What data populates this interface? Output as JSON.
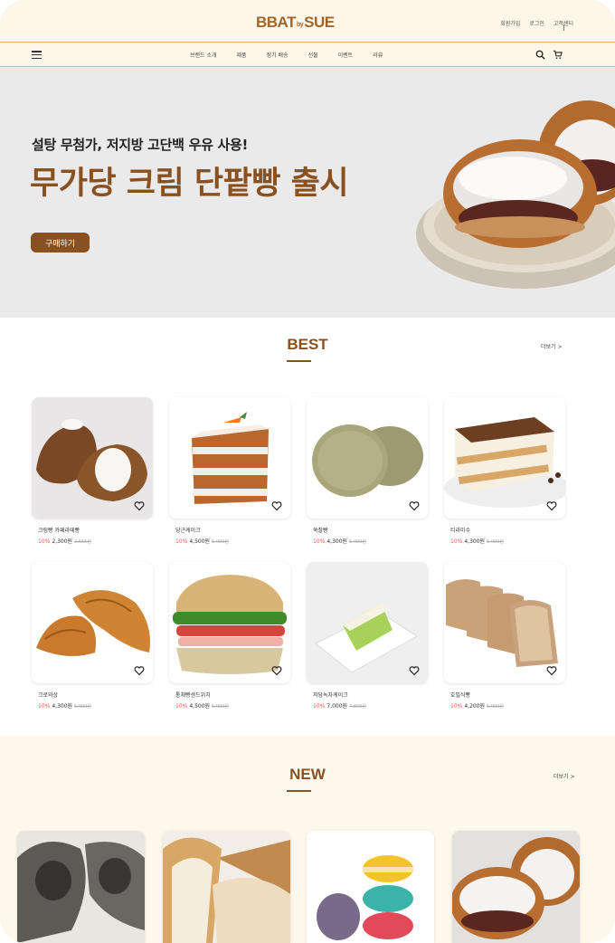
{
  "header": {
    "logo_main": "BBAT",
    "logo_small": "by",
    "logo_end": "SUE",
    "util_links": [
      "회원가입",
      "로그인",
      "고객센터"
    ]
  },
  "nav": {
    "items": [
      "브랜드 소개",
      "제품",
      "정기 배송",
      "선물",
      "이벤트",
      "리뷰"
    ],
    "icons": [
      "menu-icon",
      "search-icon",
      "cart-icon"
    ]
  },
  "hero": {
    "subtitle": "설탕 무첨가, 저지방 고단백 우유 사용!",
    "title": "무가당 크림 단팥빵 출시",
    "button": "구매하기"
  },
  "best": {
    "title": "BEST",
    "more": "더보기 >",
    "products": [
      {
        "name": "크림빵 카페라떼빵",
        "discount": "10%",
        "price": "2,300원",
        "original": "2,555원"
      },
      {
        "name": "당근케이크",
        "discount": "10%",
        "price": "4,500원",
        "original": "5,000원"
      },
      {
        "name": "쑥찰빵",
        "discount": "10%",
        "price": "4,300원",
        "original": "5,000원"
      },
      {
        "name": "티라미수",
        "discount": "10%",
        "price": "4,300원",
        "original": "5,000원"
      },
      {
        "name": "크로와상",
        "discount": "10%",
        "price": "4,300원",
        "original": "5,000원"
      },
      {
        "name": "통채빵샌드위치",
        "discount": "10%",
        "price": "4,500원",
        "original": "5,000원"
      },
      {
        "name": "저당녹차케이크",
        "discount": "10%",
        "price": "7,000원",
        "original": "7,800원"
      },
      {
        "name": "호밀식빵",
        "discount": "10%",
        "price": "4,200원",
        "original": "5,000원"
      }
    ]
  },
  "new": {
    "title": "NEW",
    "more": "더보기 >"
  },
  "colors": {
    "brand": "#8a5120",
    "accent_bg": "#fdf7e9",
    "discount": "#e0584b"
  }
}
